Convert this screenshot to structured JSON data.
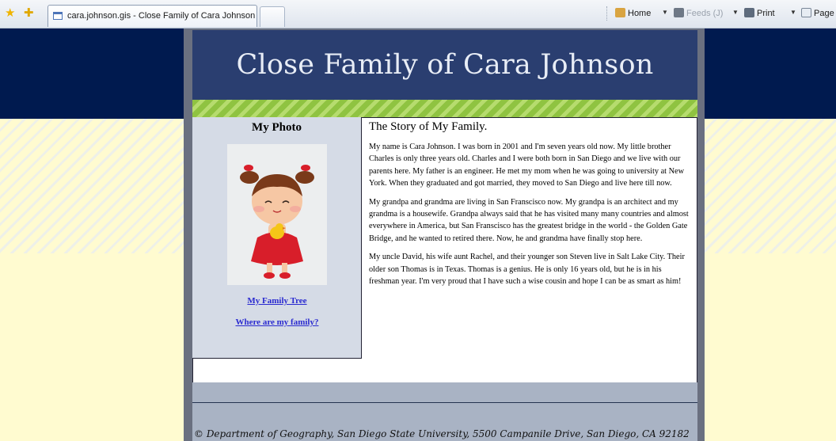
{
  "browser": {
    "tab_title": "cara.johnson.gis - Close Family of Cara Johnson",
    "commands": {
      "home": "Home",
      "feeds": "Feeds (J)",
      "print": "Print",
      "page": "Page"
    }
  },
  "page": {
    "title": "Close Family of Cara Johnson",
    "sidebar": {
      "heading": "My Photo",
      "links": [
        "My Family Tree",
        "Where are my family?"
      ]
    },
    "story": {
      "heading": "The Story of My Family.",
      "paragraphs": [
        "My name is Cara Johnson. I was born in 2001 and I'm seven years old now. My little brother Charles is only three years old. Charles and I were both born in San Diego and we live with our parents here. My father is an engineer. He met my mom when he was going to university at New York. When they graduated and got married, they moved to San Diego and live here till now.",
        "My grandpa and grandma are living in San Franscisco now. My grandpa is an architect and my grandma is a housewife. Grandpa always said that he has visited many many countries and almost everywhere in America, but San Franscisco has the greatest bridge in the world - the Golden Gate Bridge, and he wanted to retired there. Now, he and grandma have finally stop here.",
        "My uncle David, his wife aunt Rachel, and their younger son Steven live in Salt Lake City. Their older son Thomas is in Texas. Thomas is a genius. He is only 16 years old, but he is  in his freshman year. I'm very proud that I have such a wise cousin and hope I can be as smart as him!"
      ]
    },
    "footer": "© Department of Geography, San Diego State University, 5500 Campanile Drive, San Diego, CA 92182"
  },
  "colors": {
    "header_bg": "#2a3e70",
    "navy_band": "#001a4f",
    "green_strip": "#8fc341",
    "sidebar_bg": "#d5dbe6",
    "footer_bg": "#a9b3c4",
    "link": "#2a2ad0"
  },
  "icons": [
    "favorites-star-icon",
    "add-favorites-icon",
    "page-icon",
    "home-icon",
    "feeds-icon",
    "print-icon",
    "page-menu-icon"
  ]
}
